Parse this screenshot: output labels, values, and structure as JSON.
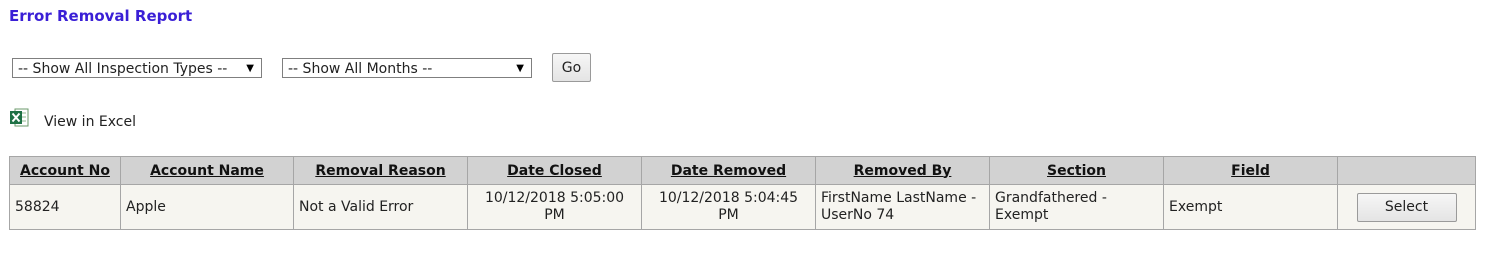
{
  "page": {
    "title": "Error Removal Report"
  },
  "filters": {
    "inspection_types_selected": "-- Show All Inspection Types --",
    "months_selected": "-- Show All Months --",
    "go_label": "Go"
  },
  "export": {
    "excel_label": "View in Excel",
    "icon": "excel-icon",
    "icon_color": "#1e7145"
  },
  "table": {
    "columns": [
      "Account No",
      "Account Name",
      "Removal Reason",
      "Date Closed",
      "Date Removed",
      "Removed By",
      "Section",
      "Field",
      ""
    ],
    "rows": [
      {
        "account_no": "58824",
        "account_name": "Apple",
        "removal_reason": "Not a Valid Error",
        "date_closed": "10/12/2018 5:05:00 PM",
        "date_removed": "10/12/2018 5:04:45 PM",
        "removed_by": "FirstName LastName - UserNo 74",
        "section": "Grandfathered - Exempt",
        "field": "Exempt",
        "action_label": "Select"
      }
    ]
  },
  "colors": {
    "title": "#3a1fd6",
    "header_bg": "#d2d2d2",
    "row_bg": "#f6f5f0"
  }
}
